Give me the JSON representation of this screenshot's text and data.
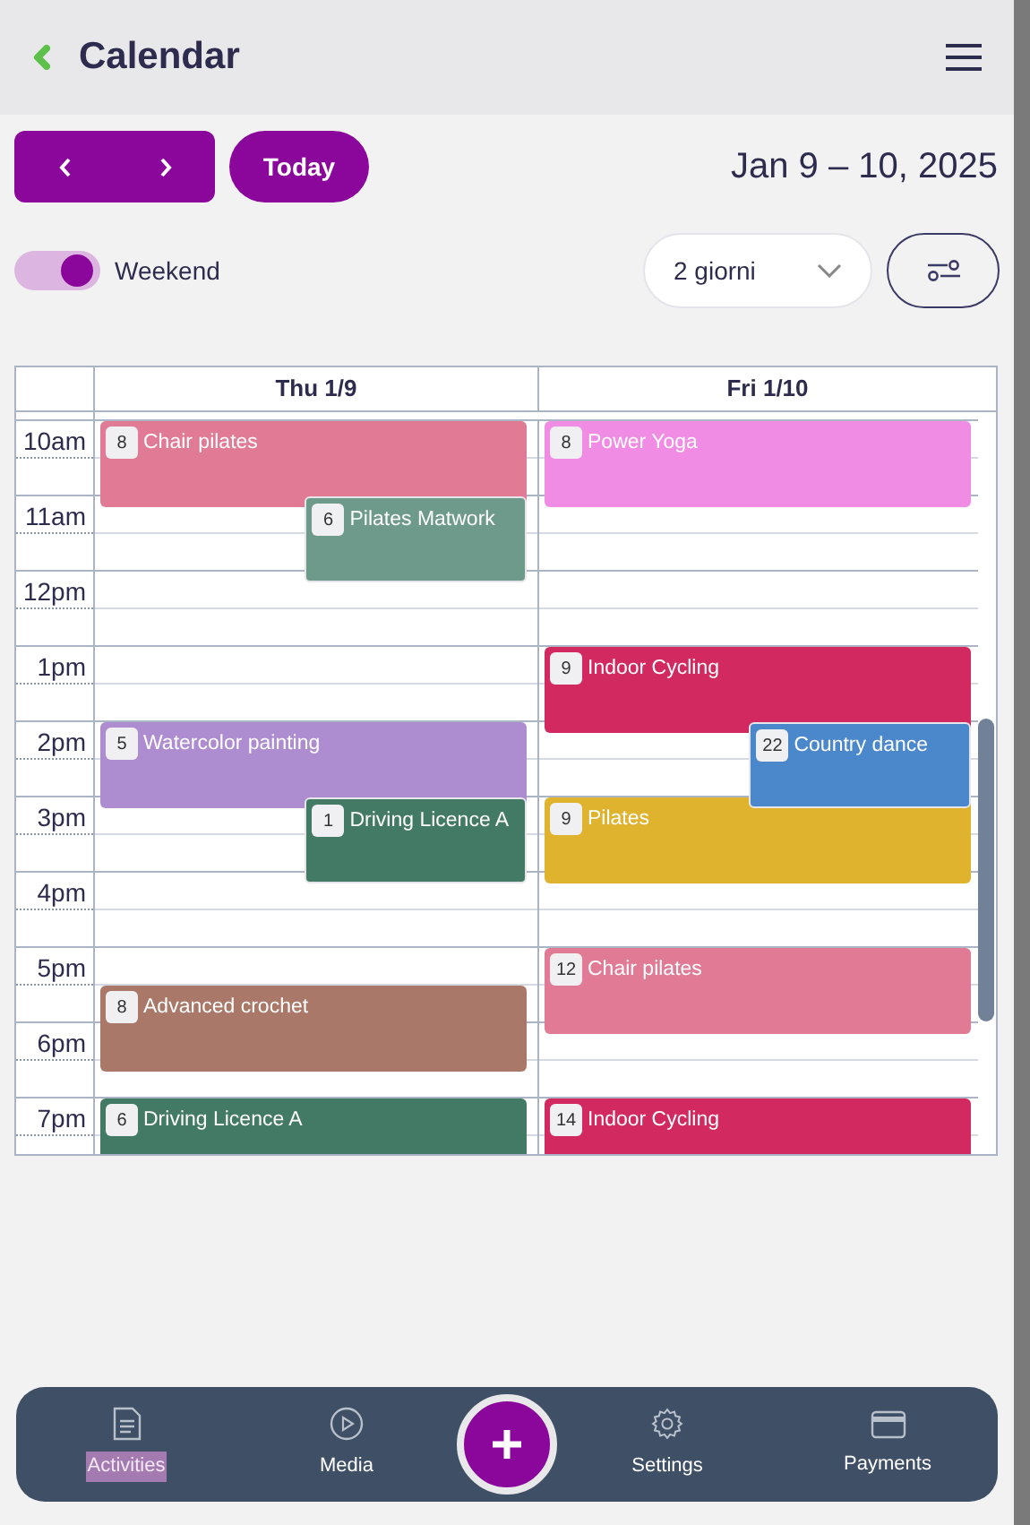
{
  "header": {
    "title": "Calendar"
  },
  "toolbar": {
    "today": "Today",
    "range": "Jan 9 – 10, 2025",
    "weekend": {
      "label": "Weekend",
      "on": true
    },
    "view": "2 giorni"
  },
  "calendar": {
    "hours": [
      "10am",
      "11am",
      "12pm",
      "1pm",
      "2pm",
      "3pm",
      "4pm",
      "5pm",
      "6pm",
      "7pm"
    ],
    "days": [
      {
        "label": "Thu 1/9",
        "events": [
          {
            "title": "Chair pilates",
            "count": "8",
            "color": "#e07a95"
          },
          {
            "title": "Pilates Matwork",
            "count": "6",
            "color": "#6e9a8b"
          },
          {
            "title": "Watercolor painting",
            "count": "5",
            "color": "#ad8ccf"
          },
          {
            "title": "Driving Licence A",
            "count": "1",
            "color": "#437a66"
          },
          {
            "title": "Advanced crochet",
            "count": "8",
            "color": "#aa7868"
          },
          {
            "title": "Driving Licence A",
            "count": "6",
            "color": "#437a66"
          }
        ]
      },
      {
        "label": "Fri 1/10",
        "events": [
          {
            "title": "Power Yoga",
            "count": "8",
            "color": "#f08ce3"
          },
          {
            "title": "Indoor Cycling",
            "count": "9",
            "color": "#d22961"
          },
          {
            "title": "Country dance",
            "count": "22",
            "color": "#4a88cb"
          },
          {
            "title": "Pilates",
            "count": "9",
            "color": "#e0b32e"
          },
          {
            "title": "Chair pilates",
            "count": "12",
            "color": "#e07a95"
          },
          {
            "title": "Indoor Cycling",
            "count": "14",
            "color": "#d22961"
          }
        ]
      }
    ]
  },
  "bottom_nav": {
    "items": [
      {
        "label": "Activities",
        "selected": true
      },
      {
        "label": "Media",
        "selected": false
      },
      {
        "label": "Settings",
        "selected": false
      },
      {
        "label": "Payments",
        "selected": false
      }
    ]
  }
}
